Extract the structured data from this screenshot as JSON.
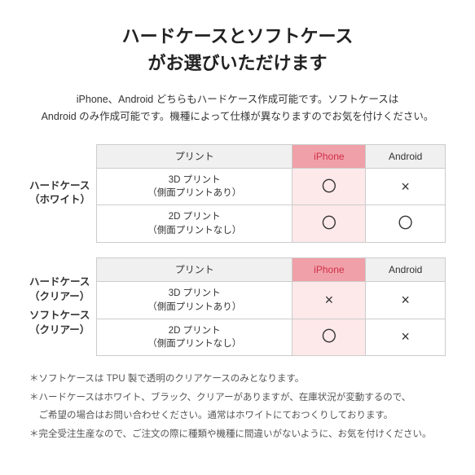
{
  "title": {
    "line1": "ハードケースとソフトケース",
    "line2": "がお選びいただけます"
  },
  "description": "iPhone、Android どちらもハードケース作成可能です。ソフトケースは\nAndroid のみ作成可能です。機種によって仕様が異なりますのでお気を付けください。",
  "section1": {
    "row_label": "ハードケース\n（ホワイト）",
    "headers": {
      "print": "プリント",
      "iphone": "iPhone",
      "android": "Android"
    },
    "rows": [
      {
        "print": "3D プリント\n（側面プリントあり）",
        "iphone": "〇",
        "android": "×"
      },
      {
        "print": "2D プリント\n（側面プリントなし）",
        "iphone": "〇",
        "android": "〇"
      }
    ]
  },
  "section2": {
    "row_label_hard": "ハードケース\n（クリアー）",
    "row_label_soft": "ソフトケース\n（クリアー）",
    "headers": {
      "print": "プリント",
      "iphone": "iPhone",
      "android": "Android"
    },
    "rows": [
      {
        "print": "3D プリント\n（側面プリントあり）",
        "iphone": "×",
        "android": "×"
      },
      {
        "print": "2D プリント\n（側面プリントなし）",
        "iphone": "〇",
        "android": "×"
      }
    ]
  },
  "notes": [
    "＊ソフトケースは TPU 製で透明のクリアケースのみとなります。",
    "＊ハードケースはホワイト、ブラック、クリアーがありますが、在庫状況が変動するので、",
    "　ご希望の場合はお問い合わせください。通常はホワイトにておつくりしております。",
    "＊完全受注生産なので、ご注文の際に種類や機種に間違いがないように、お気を付けください。"
  ]
}
